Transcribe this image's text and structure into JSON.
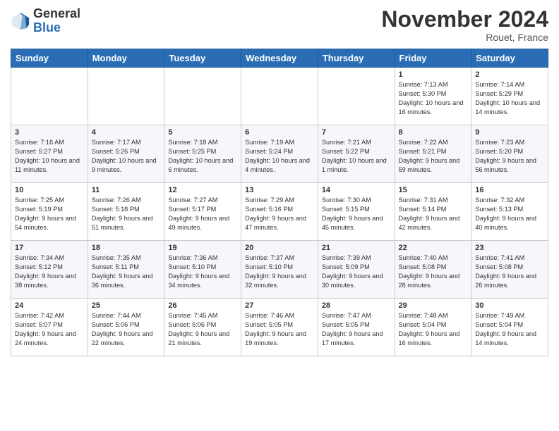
{
  "header": {
    "logo_general": "General",
    "logo_blue": "Blue",
    "month_title": "November 2024",
    "location": "Rouet, France"
  },
  "weekdays": [
    "Sunday",
    "Monday",
    "Tuesday",
    "Wednesday",
    "Thursday",
    "Friday",
    "Saturday"
  ],
  "weeks": [
    [
      {
        "day": "",
        "info": ""
      },
      {
        "day": "",
        "info": ""
      },
      {
        "day": "",
        "info": ""
      },
      {
        "day": "",
        "info": ""
      },
      {
        "day": "",
        "info": ""
      },
      {
        "day": "1",
        "info": "Sunrise: 7:13 AM\nSunset: 5:30 PM\nDaylight: 10 hours and 16 minutes."
      },
      {
        "day": "2",
        "info": "Sunrise: 7:14 AM\nSunset: 5:29 PM\nDaylight: 10 hours and 14 minutes."
      }
    ],
    [
      {
        "day": "3",
        "info": "Sunrise: 7:16 AM\nSunset: 5:27 PM\nDaylight: 10 hours and 11 minutes."
      },
      {
        "day": "4",
        "info": "Sunrise: 7:17 AM\nSunset: 5:26 PM\nDaylight: 10 hours and 9 minutes."
      },
      {
        "day": "5",
        "info": "Sunrise: 7:18 AM\nSunset: 5:25 PM\nDaylight: 10 hours and 6 minutes."
      },
      {
        "day": "6",
        "info": "Sunrise: 7:19 AM\nSunset: 5:24 PM\nDaylight: 10 hours and 4 minutes."
      },
      {
        "day": "7",
        "info": "Sunrise: 7:21 AM\nSunset: 5:22 PM\nDaylight: 10 hours and 1 minute."
      },
      {
        "day": "8",
        "info": "Sunrise: 7:22 AM\nSunset: 5:21 PM\nDaylight: 9 hours and 59 minutes."
      },
      {
        "day": "9",
        "info": "Sunrise: 7:23 AM\nSunset: 5:20 PM\nDaylight: 9 hours and 56 minutes."
      }
    ],
    [
      {
        "day": "10",
        "info": "Sunrise: 7:25 AM\nSunset: 5:19 PM\nDaylight: 9 hours and 54 minutes."
      },
      {
        "day": "11",
        "info": "Sunrise: 7:26 AM\nSunset: 5:18 PM\nDaylight: 9 hours and 51 minutes."
      },
      {
        "day": "12",
        "info": "Sunrise: 7:27 AM\nSunset: 5:17 PM\nDaylight: 9 hours and 49 minutes."
      },
      {
        "day": "13",
        "info": "Sunrise: 7:29 AM\nSunset: 5:16 PM\nDaylight: 9 hours and 47 minutes."
      },
      {
        "day": "14",
        "info": "Sunrise: 7:30 AM\nSunset: 5:15 PM\nDaylight: 9 hours and 45 minutes."
      },
      {
        "day": "15",
        "info": "Sunrise: 7:31 AM\nSunset: 5:14 PM\nDaylight: 9 hours and 42 minutes."
      },
      {
        "day": "16",
        "info": "Sunrise: 7:32 AM\nSunset: 5:13 PM\nDaylight: 9 hours and 40 minutes."
      }
    ],
    [
      {
        "day": "17",
        "info": "Sunrise: 7:34 AM\nSunset: 5:12 PM\nDaylight: 9 hours and 38 minutes."
      },
      {
        "day": "18",
        "info": "Sunrise: 7:35 AM\nSunset: 5:11 PM\nDaylight: 9 hours and 36 minutes."
      },
      {
        "day": "19",
        "info": "Sunrise: 7:36 AM\nSunset: 5:10 PM\nDaylight: 9 hours and 34 minutes."
      },
      {
        "day": "20",
        "info": "Sunrise: 7:37 AM\nSunset: 5:10 PM\nDaylight: 9 hours and 32 minutes."
      },
      {
        "day": "21",
        "info": "Sunrise: 7:39 AM\nSunset: 5:09 PM\nDaylight: 9 hours and 30 minutes."
      },
      {
        "day": "22",
        "info": "Sunrise: 7:40 AM\nSunset: 5:08 PM\nDaylight: 9 hours and 28 minutes."
      },
      {
        "day": "23",
        "info": "Sunrise: 7:41 AM\nSunset: 5:08 PM\nDaylight: 9 hours and 26 minutes."
      }
    ],
    [
      {
        "day": "24",
        "info": "Sunrise: 7:42 AM\nSunset: 5:07 PM\nDaylight: 9 hours and 24 minutes."
      },
      {
        "day": "25",
        "info": "Sunrise: 7:44 AM\nSunset: 5:06 PM\nDaylight: 9 hours and 22 minutes."
      },
      {
        "day": "26",
        "info": "Sunrise: 7:45 AM\nSunset: 5:06 PM\nDaylight: 9 hours and 21 minutes."
      },
      {
        "day": "27",
        "info": "Sunrise: 7:46 AM\nSunset: 5:05 PM\nDaylight: 9 hours and 19 minutes."
      },
      {
        "day": "28",
        "info": "Sunrise: 7:47 AM\nSunset: 5:05 PM\nDaylight: 9 hours and 17 minutes."
      },
      {
        "day": "29",
        "info": "Sunrise: 7:48 AM\nSunset: 5:04 PM\nDaylight: 9 hours and 16 minutes."
      },
      {
        "day": "30",
        "info": "Sunrise: 7:49 AM\nSunset: 5:04 PM\nDaylight: 9 hours and 14 minutes."
      }
    ]
  ]
}
